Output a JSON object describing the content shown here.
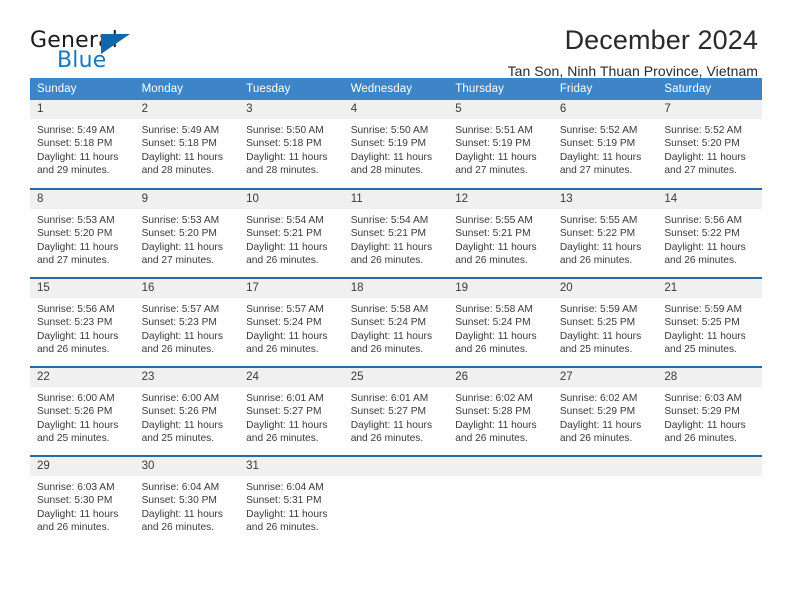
{
  "brand": {
    "name_part1": "General",
    "name_part2": "Blue",
    "triangle_color": "#1266ab",
    "blue_color": "#1878be"
  },
  "header": {
    "title": "December 2024",
    "subtitle": "Tan Son, Ninh Thuan Province, Vietnam"
  },
  "theme": {
    "header_bg": "#3d85c6",
    "row_divider": "#2a69a8",
    "daynum_bg": "#f0f0f0"
  },
  "calendar": {
    "weekday_headers": [
      "Sunday",
      "Monday",
      "Tuesday",
      "Wednesday",
      "Thursday",
      "Friday",
      "Saturday"
    ],
    "weeks": [
      [
        {
          "day": "1",
          "sunrise": "Sunrise: 5:49 AM",
          "sunset": "Sunset: 5:18 PM",
          "daylight1": "Daylight: 11 hours",
          "daylight2": "and 29 minutes."
        },
        {
          "day": "2",
          "sunrise": "Sunrise: 5:49 AM",
          "sunset": "Sunset: 5:18 PM",
          "daylight1": "Daylight: 11 hours",
          "daylight2": "and 28 minutes."
        },
        {
          "day": "3",
          "sunrise": "Sunrise: 5:50 AM",
          "sunset": "Sunset: 5:18 PM",
          "daylight1": "Daylight: 11 hours",
          "daylight2": "and 28 minutes."
        },
        {
          "day": "4",
          "sunrise": "Sunrise: 5:50 AM",
          "sunset": "Sunset: 5:19 PM",
          "daylight1": "Daylight: 11 hours",
          "daylight2": "and 28 minutes."
        },
        {
          "day": "5",
          "sunrise": "Sunrise: 5:51 AM",
          "sunset": "Sunset: 5:19 PM",
          "daylight1": "Daylight: 11 hours",
          "daylight2": "and 27 minutes."
        },
        {
          "day": "6",
          "sunrise": "Sunrise: 5:52 AM",
          "sunset": "Sunset: 5:19 PM",
          "daylight1": "Daylight: 11 hours",
          "daylight2": "and 27 minutes."
        },
        {
          "day": "7",
          "sunrise": "Sunrise: 5:52 AM",
          "sunset": "Sunset: 5:20 PM",
          "daylight1": "Daylight: 11 hours",
          "daylight2": "and 27 minutes."
        }
      ],
      [
        {
          "day": "8",
          "sunrise": "Sunrise: 5:53 AM",
          "sunset": "Sunset: 5:20 PM",
          "daylight1": "Daylight: 11 hours",
          "daylight2": "and 27 minutes."
        },
        {
          "day": "9",
          "sunrise": "Sunrise: 5:53 AM",
          "sunset": "Sunset: 5:20 PM",
          "daylight1": "Daylight: 11 hours",
          "daylight2": "and 27 minutes."
        },
        {
          "day": "10",
          "sunrise": "Sunrise: 5:54 AM",
          "sunset": "Sunset: 5:21 PM",
          "daylight1": "Daylight: 11 hours",
          "daylight2": "and 26 minutes."
        },
        {
          "day": "11",
          "sunrise": "Sunrise: 5:54 AM",
          "sunset": "Sunset: 5:21 PM",
          "daylight1": "Daylight: 11 hours",
          "daylight2": "and 26 minutes."
        },
        {
          "day": "12",
          "sunrise": "Sunrise: 5:55 AM",
          "sunset": "Sunset: 5:21 PM",
          "daylight1": "Daylight: 11 hours",
          "daylight2": "and 26 minutes."
        },
        {
          "day": "13",
          "sunrise": "Sunrise: 5:55 AM",
          "sunset": "Sunset: 5:22 PM",
          "daylight1": "Daylight: 11 hours",
          "daylight2": "and 26 minutes."
        },
        {
          "day": "14",
          "sunrise": "Sunrise: 5:56 AM",
          "sunset": "Sunset: 5:22 PM",
          "daylight1": "Daylight: 11 hours",
          "daylight2": "and 26 minutes."
        }
      ],
      [
        {
          "day": "15",
          "sunrise": "Sunrise: 5:56 AM",
          "sunset": "Sunset: 5:23 PM",
          "daylight1": "Daylight: 11 hours",
          "daylight2": "and 26 minutes."
        },
        {
          "day": "16",
          "sunrise": "Sunrise: 5:57 AM",
          "sunset": "Sunset: 5:23 PM",
          "daylight1": "Daylight: 11 hours",
          "daylight2": "and 26 minutes."
        },
        {
          "day": "17",
          "sunrise": "Sunrise: 5:57 AM",
          "sunset": "Sunset: 5:24 PM",
          "daylight1": "Daylight: 11 hours",
          "daylight2": "and 26 minutes."
        },
        {
          "day": "18",
          "sunrise": "Sunrise: 5:58 AM",
          "sunset": "Sunset: 5:24 PM",
          "daylight1": "Daylight: 11 hours",
          "daylight2": "and 26 minutes."
        },
        {
          "day": "19",
          "sunrise": "Sunrise: 5:58 AM",
          "sunset": "Sunset: 5:24 PM",
          "daylight1": "Daylight: 11 hours",
          "daylight2": "and 26 minutes."
        },
        {
          "day": "20",
          "sunrise": "Sunrise: 5:59 AM",
          "sunset": "Sunset: 5:25 PM",
          "daylight1": "Daylight: 11 hours",
          "daylight2": "and 25 minutes."
        },
        {
          "day": "21",
          "sunrise": "Sunrise: 5:59 AM",
          "sunset": "Sunset: 5:25 PM",
          "daylight1": "Daylight: 11 hours",
          "daylight2": "and 25 minutes."
        }
      ],
      [
        {
          "day": "22",
          "sunrise": "Sunrise: 6:00 AM",
          "sunset": "Sunset: 5:26 PM",
          "daylight1": "Daylight: 11 hours",
          "daylight2": "and 25 minutes."
        },
        {
          "day": "23",
          "sunrise": "Sunrise: 6:00 AM",
          "sunset": "Sunset: 5:26 PM",
          "daylight1": "Daylight: 11 hours",
          "daylight2": "and 25 minutes."
        },
        {
          "day": "24",
          "sunrise": "Sunrise: 6:01 AM",
          "sunset": "Sunset: 5:27 PM",
          "daylight1": "Daylight: 11 hours",
          "daylight2": "and 26 minutes."
        },
        {
          "day": "25",
          "sunrise": "Sunrise: 6:01 AM",
          "sunset": "Sunset: 5:27 PM",
          "daylight1": "Daylight: 11 hours",
          "daylight2": "and 26 minutes."
        },
        {
          "day": "26",
          "sunrise": "Sunrise: 6:02 AM",
          "sunset": "Sunset: 5:28 PM",
          "daylight1": "Daylight: 11 hours",
          "daylight2": "and 26 minutes."
        },
        {
          "day": "27",
          "sunrise": "Sunrise: 6:02 AM",
          "sunset": "Sunset: 5:29 PM",
          "daylight1": "Daylight: 11 hours",
          "daylight2": "and 26 minutes."
        },
        {
          "day": "28",
          "sunrise": "Sunrise: 6:03 AM",
          "sunset": "Sunset: 5:29 PM",
          "daylight1": "Daylight: 11 hours",
          "daylight2": "and 26 minutes."
        }
      ],
      [
        {
          "day": "29",
          "sunrise": "Sunrise: 6:03 AM",
          "sunset": "Sunset: 5:30 PM",
          "daylight1": "Daylight: 11 hours",
          "daylight2": "and 26 minutes."
        },
        {
          "day": "30",
          "sunrise": "Sunrise: 6:04 AM",
          "sunset": "Sunset: 5:30 PM",
          "daylight1": "Daylight: 11 hours",
          "daylight2": "and 26 minutes."
        },
        {
          "day": "31",
          "sunrise": "Sunrise: 6:04 AM",
          "sunset": "Sunset: 5:31 PM",
          "daylight1": "Daylight: 11 hours",
          "daylight2": "and 26 minutes."
        },
        {
          "day": "",
          "sunrise": "",
          "sunset": "",
          "daylight1": "",
          "daylight2": ""
        },
        {
          "day": "",
          "sunrise": "",
          "sunset": "",
          "daylight1": "",
          "daylight2": ""
        },
        {
          "day": "",
          "sunrise": "",
          "sunset": "",
          "daylight1": "",
          "daylight2": ""
        },
        {
          "day": "",
          "sunrise": "",
          "sunset": "",
          "daylight1": "",
          "daylight2": ""
        }
      ]
    ]
  }
}
